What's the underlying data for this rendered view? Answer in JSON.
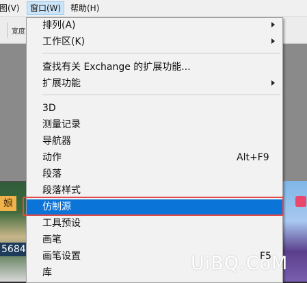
{
  "menubar": {
    "view_label": "视图(V)",
    "window_label": "窗口(W)",
    "help_label": "帮助(H)"
  },
  "optbar": {
    "labels": [
      "宽度",
      "宽度"
    ]
  },
  "menu": {
    "groups": [
      [
        {
          "label": "排列(A)",
          "submenu": true
        },
        {
          "label": "工作区(K)",
          "submenu": true
        }
      ],
      [
        {
          "label": "查找有关 Exchange 的扩展功能...",
          "submenu": false
        },
        {
          "label": "扩展功能",
          "submenu": true
        }
      ],
      [
        {
          "label": "3D",
          "shortcut": ""
        },
        {
          "label": "测量记录",
          "shortcut": ""
        },
        {
          "label": "导航器",
          "shortcut": ""
        },
        {
          "label": "动作",
          "shortcut": "Alt+F9"
        },
        {
          "label": "段落",
          "shortcut": ""
        },
        {
          "label": "段落样式",
          "shortcut": ""
        },
        {
          "label": "仿制源",
          "shortcut": "",
          "highlighted": true
        },
        {
          "label": "工具预设",
          "shortcut": ""
        },
        {
          "label": "画笔",
          "shortcut": ""
        },
        {
          "label": "画笔设置",
          "shortcut": "F5"
        },
        {
          "label": "库",
          "shortcut": ""
        }
      ]
    ]
  },
  "background": {
    "left_tag": "娘",
    "left_number": "5684"
  },
  "watermark": "UiBQ.CoM",
  "colors": {
    "highlight": "#0a74d9",
    "outline": "#e04a4a"
  }
}
